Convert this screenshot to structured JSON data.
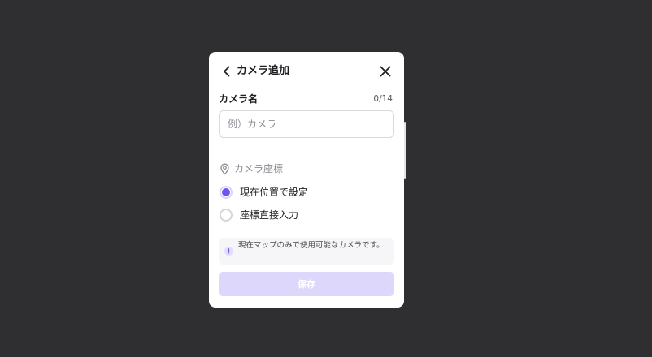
{
  "modal": {
    "title": "カメラ追加",
    "back_icon": "chevron-left-icon",
    "close_icon": "close-icon"
  },
  "camera_name": {
    "label": "カメラ名",
    "char_count": "0/14",
    "value": "",
    "placeholder": "例）カメラ"
  },
  "coordinates": {
    "section_label": "カメラ座標",
    "icon": "map-pin-icon",
    "options": [
      {
        "label": "現在位置で設定",
        "selected": true
      },
      {
        "label": "座標直接入力",
        "selected": false
      }
    ]
  },
  "info": {
    "icon": "exclamation-icon",
    "text": "現在マップのみで使用可能なカメラです。"
  },
  "save_button": {
    "label": "保存",
    "disabled": true
  },
  "colors": {
    "background": "#2f2f31",
    "accent": "#6b57e8",
    "accent_light": "#ddd8fb",
    "text_primary": "#1f1f23",
    "text_muted": "#8a8a92"
  }
}
